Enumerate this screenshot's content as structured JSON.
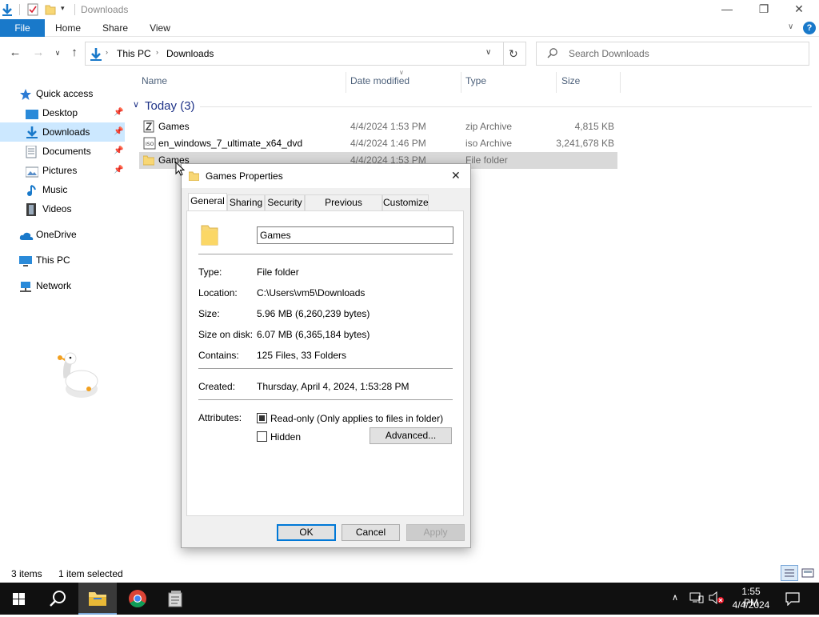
{
  "window": {
    "title": "Downloads",
    "minimize_glyph": "—",
    "maximize_glyph": "❐",
    "close_glyph": "✕"
  },
  "ribbon": {
    "tabs": [
      "File",
      "Home",
      "Share",
      "View"
    ]
  },
  "address": {
    "crumbs": [
      "This PC",
      "Downloads"
    ],
    "search_placeholder": "Search Downloads"
  },
  "sidebar": {
    "quick_access": "Quick access",
    "items": [
      {
        "label": "Desktop",
        "icon": "desktop-icon",
        "pinned": true
      },
      {
        "label": "Downloads",
        "icon": "downloads-icon",
        "pinned": true,
        "selected": true
      },
      {
        "label": "Documents",
        "icon": "documents-icon",
        "pinned": true
      },
      {
        "label": "Pictures",
        "icon": "pictures-icon",
        "pinned": true
      },
      {
        "label": "Music",
        "icon": "music-icon",
        "pinned": false
      },
      {
        "label": "Videos",
        "icon": "videos-icon",
        "pinned": false
      }
    ],
    "onedrive": "OneDrive",
    "thispc": "This PC",
    "network": "Network"
  },
  "filelist": {
    "columns": [
      "Name",
      "Date modified",
      "Type",
      "Size"
    ],
    "group": "Today (3)",
    "rows": [
      {
        "name": "Games",
        "date": "4/4/2024 1:53 PM",
        "type": "zip Archive",
        "size": "4,815 KB",
        "icon": "zip-icon"
      },
      {
        "name": "en_windows_7_ultimate_x64_dvd",
        "date": "4/4/2024 1:46 PM",
        "type": "iso Archive",
        "size": "3,241,678 KB",
        "icon": "iso-icon"
      },
      {
        "name": "Games",
        "date": "4/4/2024 1:53 PM",
        "type": "File folder",
        "size": "",
        "icon": "folder-icon"
      }
    ]
  },
  "dialog": {
    "title": "Games Properties",
    "tabs": [
      "General",
      "Sharing",
      "Security",
      "Previous Versions",
      "Customize"
    ],
    "name_value": "Games",
    "labels": {
      "type": "Type:",
      "location": "Location:",
      "size": "Size:",
      "size_on_disk": "Size on disk:",
      "contains": "Contains:",
      "created": "Created:",
      "attributes": "Attributes:"
    },
    "values": {
      "type": "File folder",
      "location": "C:\\Users\\vm5\\Downloads",
      "size": "5.96 MB (6,260,239 bytes)",
      "size_on_disk": "6.07 MB (6,365,184 bytes)",
      "contains": "125 Files, 33 Folders",
      "created": "Thursday, April 4, 2024, 1:53:28 PM"
    },
    "readonly_label": "Read-only (Only applies to files in folder)",
    "hidden_label": "Hidden",
    "advanced_label": "Advanced...",
    "ok_label": "OK",
    "cancel_label": "Cancel",
    "apply_label": "Apply",
    "readonly_checked": "indeterminate",
    "hidden_checked": false
  },
  "statusbar": {
    "count": "3 items",
    "selected": "1 item selected"
  },
  "taskbar": {
    "time": "1:55 PM",
    "date": "4/4/2024"
  },
  "colors": {
    "accent": "#1979ca",
    "selection": "#cce8ff",
    "header_text": "#4c607a",
    "group_text": "#1e3287"
  }
}
